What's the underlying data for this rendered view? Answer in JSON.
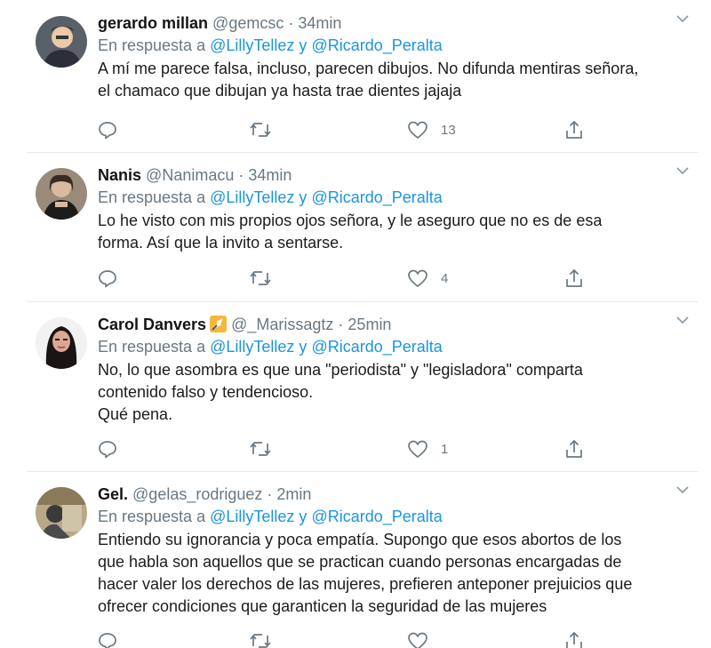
{
  "tweets": [
    {
      "name": "gerardo millan",
      "handle": "@gemcsc",
      "time": "34min",
      "reply_prefix": "En respuesta a",
      "mention1": "@LillyTellez",
      "reply_and": "y",
      "mention2": "@Ricardo_Peralta",
      "lines": [
        "A mí me parece falsa, incluso, parecen dibujos. No difunda mentiras señora,",
        "el chamaco que dibujan ya hasta trae dientes jajaja"
      ],
      "likes": "13",
      "avatar_colors": [
        "#2b2f3a",
        "#e9c9a8"
      ]
    },
    {
      "name": "Nanis",
      "handle": "@Nanimacu",
      "time": "34min",
      "reply_prefix": "En respuesta a",
      "mention1": "@LillyTellez",
      "reply_and": "y",
      "mention2": "@Ricardo_Peralta",
      "lines": [
        "Lo he visto con mis propios ojos señora, y le aseguro que no es de esa",
        "forma. Así que la invito a sentarse."
      ],
      "likes": "4",
      "avatar_colors": [
        "#6a5a4a",
        "#d9b9a0"
      ]
    },
    {
      "name": "Carol Danvers",
      "handle": "@_Marissagtz",
      "time": "25min",
      "reply_prefix": "En respuesta a",
      "mention1": "@LillyTellez",
      "reply_and": "y",
      "mention2": "@Ricardo_Peralta",
      "lines": [
        "No, lo que asombra es que una \"periodista\" y \"legisladora\" comparta",
        "contenido falso y tendencioso.",
        "Qué pena."
      ],
      "likes": "1",
      "avatar_colors": [
        "#1a1414",
        "#d8a892"
      ]
    },
    {
      "name": "Gel.",
      "handle": "@gelas_rodriguez",
      "time": "2min",
      "reply_prefix": "En respuesta a",
      "mention1": "@LillyTellez",
      "reply_and": "y",
      "mention2": "@Ricardo_Peralta",
      "lines": [
        "Entiendo su ignorancia y poca empatía. Supongo que esos abortos de los",
        "que habla son aquellos que se practican cuando personas encargadas de",
        "hacer valer los derechos de las mujeres, prefieren anteponer prejuicios que",
        "ofrecer condiciones que garanticen la seguridad de las mujeres"
      ],
      "likes": "",
      "avatar_colors": [
        "#8a7a5a",
        "#3a3a3a"
      ]
    }
  ],
  "separator": "·",
  "colors": {
    "mention": "#1b95e0",
    "muted": "#697882",
    "divider": "#e4e9ed",
    "badge": "#f5b73b"
  },
  "icons": [
    "reply-icon",
    "retweet-icon",
    "like-icon",
    "share-icon",
    "caret-down-icon",
    "verified-badge-icon"
  ]
}
